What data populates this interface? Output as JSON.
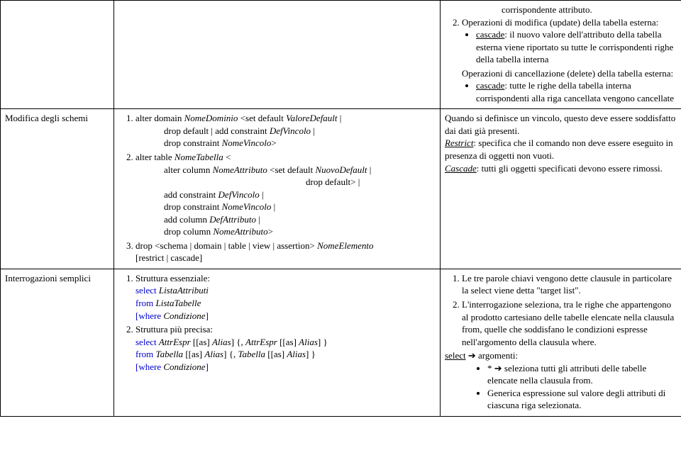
{
  "rows": {
    "r0": {
      "right": {
        "trail": "corrispondente attributo.",
        "item2_lead": "Operazioni di modifica (update) della tabella esterna:",
        "bul1a": "cascade",
        "bul1b": ": il nuovo valore dell'attributo della tabella esterna viene riportato su tutte le corrispondenti righe della tabella interna",
        "cancel_lead": "Operazioni di cancellazione (delete) della tabella esterna:",
        "bul2a": "cascade",
        "bul2b": ": tutte le righe della tabella interna corrispondenti alla riga cancellata vengono cancellate"
      }
    },
    "r1": {
      "left": "Modifica degli schemi",
      "mid": {
        "i1a": "alter domain ",
        "i1b": "NomeDominio",
        "i1c": " <set default ",
        "i1d": "ValoreDefault",
        "i1e": " |",
        "i1l2a": "drop default | add constraint ",
        "i1l2b": "DefVincolo",
        "i1l2c": " |",
        "i1l3a": "drop constraint ",
        "i1l3b": "NomeVincolo",
        "i1l3c": ">",
        "i2a": "alter table ",
        "i2b": "NomeTabella",
        "i2c": " <",
        "i2l2a": "alter column ",
        "i2l2b": "NomeAttributo",
        "i2l2c": " <set default ",
        "i2l2d": "NuovoDefault",
        "i2l2e": " |",
        "i2l3a": "drop default> |",
        "i2l4a": "add constraint ",
        "i2l4b": "DefVincolo",
        "i2l4c": " |",
        "i2l5a": "drop constraint ",
        "i2l5b": "NomeVincolo",
        "i2l5c": " |",
        "i2l6a": "add column ",
        "i2l6b": "DefAttributo",
        "i2l6c": " |",
        "i2l7a": "drop column ",
        "i2l7b": "NomeAttributo",
        "i2l7c": ">",
        "i3a": "drop <schema | domain | table | view | assertion> ",
        "i3b": "NomeElemento",
        "i3l2a": "[restrict | cascade]"
      },
      "right": {
        "p1": "Quando si definisce un vincolo, questo deve essere soddisfatto dai dati già presenti.",
        "p2a": "Restrict",
        "p2b": ": specifica che il comando non deve essere eseguito in presenza di oggetti non vuoti.",
        "p3a": "Cascade",
        "p3b": ": tutti gli oggetti specificati devono essere rimossi."
      }
    },
    "r2": {
      "left": "Interrogazioni semplici",
      "mid": {
        "i1a": "Struttura essenziale:",
        "i1l2a": "select ",
        "i1l2b": "ListaAttributi",
        "i1l3a": "from ",
        "i1l3b": "ListaTabelle",
        "i1l4a": "[where ",
        "i1l4b": "Condizione",
        "i1l4c": "]",
        "i2a": "Struttura più precisa:",
        "i2l2a": "select ",
        "i2l2b": "AttrEspr",
        "i2l2c": " [[as] ",
        "i2l2d": "Alias",
        "i2l2e": "] {, ",
        "i2l2f": "AttrEspr",
        "i2l2g": " [[as] ",
        "i2l2h": "Alias",
        "i2l2i": "] }",
        "i2l3a": "from ",
        "i2l3b": "Tabella",
        "i2l3c": " [[as] ",
        "i2l3d": "Alias",
        "i2l3e": "] {, ",
        "i2l3f": "Tabella",
        "i2l3g": " [[as] ",
        "i2l3h": "Alias",
        "i2l3i": "] }",
        "i2l4a": "[where ",
        "i2l4b": "Condizione",
        "i2l4c": "]"
      },
      "right": {
        "n1": "Le tre parole chiavi vengono dette clausule in particolare la select viene detta \"target list\".",
        "n2": "L'interrogazione seleziona, tra le righe che appartengono al prodotto cartesiano delle tabelle elencate nella clausula from, quelle che soddisfano le condizioni espresse nell'argomento della clausula where.",
        "sel_a": "select",
        "sel_b": " ➔ argomenti:",
        "b1": "* ➔ seleziona tutti gli attributi delle tabelle elencate nella clausula from.",
        "b2": "Generica espressione sul valore degli attributi di ciascuna riga selezionata."
      }
    }
  }
}
